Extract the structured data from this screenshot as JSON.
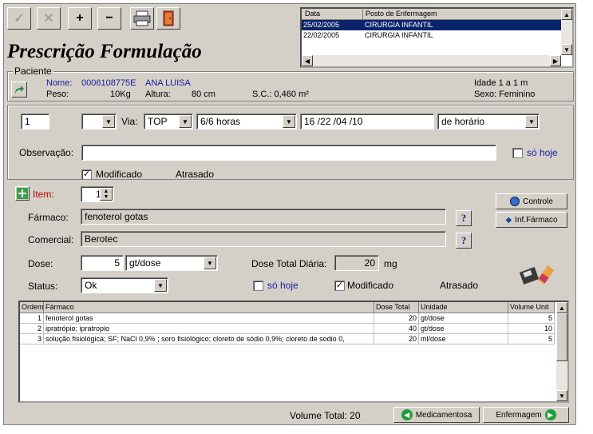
{
  "title": "Prescrição Formulação",
  "toolbar": {
    "check": "✓",
    "cancel": "✕",
    "add": "+",
    "remove": "−"
  },
  "datelist": {
    "headers": [
      "Data",
      "Posto de Enfermagem"
    ],
    "rows": [
      [
        "25/02/2005",
        "CIRURGIA INFANTIL"
      ],
      [
        "22/02/2005",
        "CIRURGIA INFANTIL"
      ]
    ]
  },
  "patient": {
    "group_label": "Paciente",
    "name_label": "Nome:",
    "name_id": "0006108775E",
    "name": "ANA LUISA",
    "weight_label": "Peso:",
    "weight": "10Kg",
    "height_label": "Altura:",
    "height": "80  cm",
    "sc": "S.C.: 0,460 m²",
    "age": "Idade 1 a 1 m",
    "sex": "Sexo: Feminino"
  },
  "schedule": {
    "number": "1",
    "via_label": "Via:",
    "via": "TOP",
    "frequency": "6/6 horas",
    "times": "16   /22   /04   /10",
    "type": "de horário",
    "obs_label": "Observação:",
    "obs_value": "",
    "so_hoje": "só hoje",
    "modificado": "Modificado",
    "atrasado": "Atrasado"
  },
  "item": {
    "label": "Item:",
    "number": "1",
    "farmaco_label": "Fármaco:",
    "farmaco": "fenoterol gotas",
    "comercial_label": "Comercial:",
    "comercial": "Berotec",
    "dose_label": "Dose:",
    "dose": "5",
    "dose_unit": "gt/dose",
    "dose_total_label": "Dose Total Diária:",
    "dose_total": "20",
    "dose_total_unit": "mg",
    "status_label": "Status:",
    "status": "Ok",
    "so_hoje": "só hoje",
    "modificado": "Modificado",
    "atrasado": "Atrasado",
    "help": "?",
    "controle_btn": "Controle",
    "inf_farmaco_btn": "Inf.Fármaco"
  },
  "table": {
    "headers": [
      "Ordem",
      "Fármaco",
      "Dose Total",
      "Unidade",
      "Volume Unit"
    ],
    "rows": [
      [
        "1",
        "fenoterol gotas",
        "20",
        "gt/dose",
        "5"
      ],
      [
        "2",
        "ipratrópio; ipratropio",
        "40",
        "gt/dose",
        "10"
      ],
      [
        "3",
        "solução fisiológica; SF; NaCl 0,9% ; soro fisiológico; cloreto de sódio 0,9%; cloreto de sodio 0,",
        "20",
        "ml/dose",
        "5"
      ]
    ]
  },
  "footer": {
    "volume_total": "Volume Total: 20",
    "medicamentosa_btn": "Medicamentosa",
    "enfermagem_btn": "Enfermagem"
  }
}
